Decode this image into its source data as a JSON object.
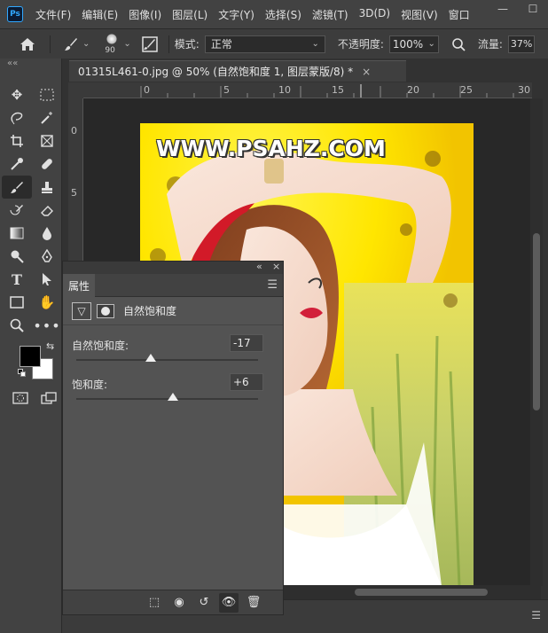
{
  "app": {
    "logo": "Ps"
  },
  "menu": [
    "文件(F)",
    "编辑(E)",
    "图像(I)",
    "图层(L)",
    "文字(Y)",
    "选择(S)",
    "滤镜(T)",
    "3D(D)",
    "视图(V)",
    "窗口"
  ],
  "window_controls": {
    "minimize": "—",
    "maximize": "☐"
  },
  "options": {
    "brush_size": "90",
    "mode_label": "模式:",
    "mode_value": "正常",
    "opacity_label": "不透明度:",
    "opacity_value": "100%",
    "flow_label": "流量:",
    "flow_value": "37%"
  },
  "document": {
    "tab_title": "01315L461-0.jpg @ 50% (自然饱和度 1, 图层蒙版/8) *",
    "close": "×",
    "watermark": "WWW.PSAHZ.COM"
  },
  "rulers": {
    "top": [
      "0",
      "5",
      "10",
      "15",
      "20",
      "25",
      "30"
    ],
    "left": [
      "0",
      "5"
    ]
  },
  "properties": {
    "tab": "属性",
    "collapse": "«",
    "close": "×",
    "title": "自然饱和度",
    "vibrance_label": "自然饱和度:",
    "vibrance_value": "-17",
    "vibrance_fraction": 0.41,
    "saturation_label": "饱和度:",
    "saturation_value": "+6",
    "saturation_fraction": 0.53
  },
  "colors": {
    "foreground": "#000000",
    "background": "#ffffff",
    "accent": "#31a8ff"
  }
}
